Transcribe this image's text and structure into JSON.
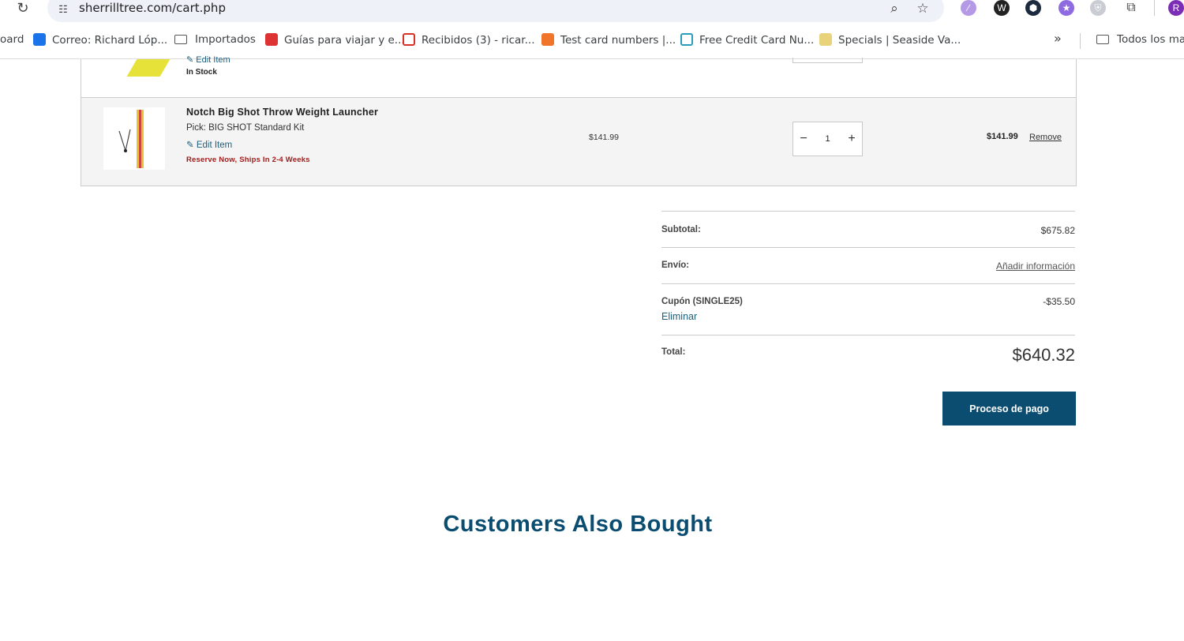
{
  "browser": {
    "url": "sherrilltree.com/cart.php",
    "bookmarks": [
      {
        "label": "oard"
      },
      {
        "label": "Correo: Richard Lóp..."
      },
      {
        "label": "Importados"
      },
      {
        "label": "Guías para viajar y e..."
      },
      {
        "label": "Recibidos (3) - ricar..."
      },
      {
        "label": "Test card numbers |..."
      },
      {
        "label": "Free Credit Card Nu..."
      },
      {
        "label": "Specials | Seaside Va..."
      },
      {
        "label": "Todos los marc"
      }
    ],
    "profile_initial": "R",
    "icons": [
      "reload-icon",
      "site-info-icon",
      "zoom-icon",
      "star-icon",
      "extension-icons",
      "puzzle-icon",
      "chevron-double-right-icon"
    ]
  },
  "cart": {
    "prev_item": {
      "edit_label": "Edit Item",
      "stock": "In Stock"
    },
    "item": {
      "name": "Notch Big Shot Throw Weight Launcher",
      "option": "Pick: BIG SHOT Standard Kit",
      "edit_label": "Edit Item",
      "shipping": "Reserve Now, Ships In 2-4 Weeks",
      "unit_price": "$141.99",
      "qty": "1",
      "line_total": "$141.99",
      "remove_label": "Remove"
    }
  },
  "summary": {
    "subtotal_label": "Subtotal:",
    "subtotal_value": "$675.82",
    "shipping_label": "Envío:",
    "shipping_link": "Añadir información",
    "coupon_label": "Cupón (SINGLE25)",
    "coupon_value": "-$35.50",
    "coupon_remove": "Eliminar",
    "total_label": "Total:",
    "total_value": "$640.32",
    "checkout_label": "Proceso de pago"
  },
  "related": {
    "title": "Customers Also Bought"
  },
  "colors": {
    "accent": "#0b4d70",
    "link": "#1b5f7c",
    "warning": "#a11d1d"
  }
}
